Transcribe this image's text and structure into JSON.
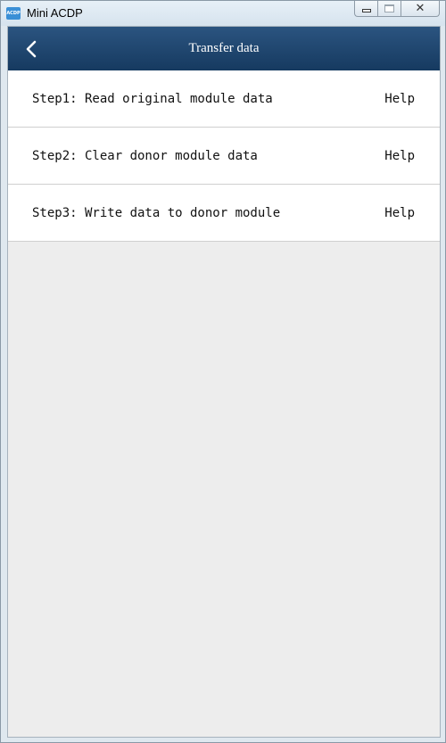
{
  "window": {
    "title": "Mini ACDP",
    "icon_label": "ACDP",
    "controls": [
      "minimize",
      "maximize",
      "close"
    ]
  },
  "header": {
    "title": "Transfer data",
    "back_icon": "chevron-left-icon"
  },
  "steps": [
    {
      "label": "Step1: Read original module data",
      "help": "Help"
    },
    {
      "label": "Step2: Clear donor module data",
      "help": "Help"
    },
    {
      "label": "Step3: Write data to donor module",
      "help": "Help"
    }
  ],
  "colors": {
    "header_bg": "#1f4770",
    "content_bg": "#ededed",
    "row_bg": "#ffffff"
  }
}
